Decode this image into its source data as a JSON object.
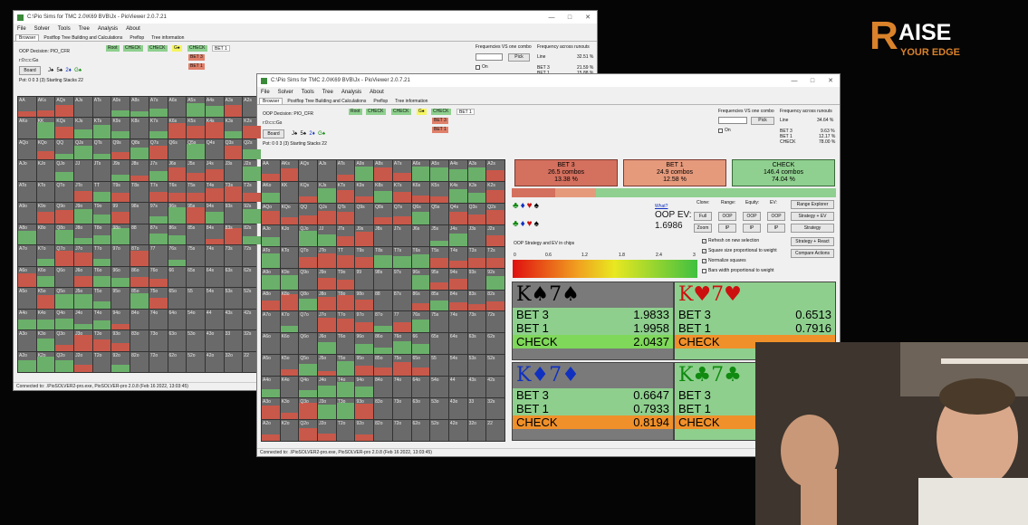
{
  "branding": {
    "logo_mark": "R",
    "logo_line1": "AISE",
    "logo_line2": "YOUR EDGE",
    "accent": "#d9822b"
  },
  "back_window": {
    "title": "C:\\Pio Sims for TMC 2.0\\K69 BVB\\Jx - PioViewer 2.0.7.21",
    "menu": [
      "File",
      "Solver",
      "Tools",
      "Tree",
      "Analysis",
      "About"
    ],
    "tabs": [
      "Browser",
      "Postflop Tree Building and Calculations",
      "Preflop",
      "Tree information"
    ],
    "decision": "OOP Decision:  PIO_CFR",
    "line": "r:0:c:c:Gs",
    "board_button": "Board",
    "board_cards": [
      "J♠",
      "5♠",
      "2♦",
      "G♠"
    ],
    "pot": "Pot: 0 0 3 (3)  Starting Stacks 22",
    "tree": [
      "Root",
      "CHECK",
      "CHECK",
      "G♠",
      "CHECK",
      "BET 1"
    ],
    "tree_sub": [
      "BET 3",
      "BET 1"
    ],
    "freq_label": "Frequencies VS one combo",
    "freq_runouts": "Frequency across runouts",
    "pick": "Pick",
    "on_label": "On",
    "line_label": "Line",
    "line_value": "32.51 %",
    "bet3_label": "BET 3",
    "bet3_value": "21.59 %",
    "bet1_label": "BET 1",
    "bet1_value": "15.88 %",
    "status": "Connected to: .\\PioSOLVER2-pro.exe, PioSOLVER-pro 2.0.8 (Feb 16 2022, 13:03:45)"
  },
  "front_window": {
    "title": "C:\\Pio Sims for TMC 2.0\\K69 BVB\\Jx - PioViewer 2.0.7.21",
    "menu": [
      "File",
      "Solver",
      "Tools",
      "Tree",
      "Analysis",
      "About"
    ],
    "tabs": [
      "Browser",
      "Postflop Tree Building and Calculations",
      "Preflop",
      "Tree information"
    ],
    "decision": "OOP Decision:  PIO_CFR",
    "line": "r:0:c:c:Gs",
    "board_button": "Board",
    "board_cards": [
      "J♠",
      "5♠",
      "2♦",
      "G♠"
    ],
    "pot": "Pot: 0 0 3 (3)  Starting Stacks 22",
    "tree": [
      "Root",
      "CHECK",
      "CHECK",
      "G♠",
      "CHECK",
      "BET 1"
    ],
    "tree_sub": [
      "BET 3",
      "BET 1"
    ],
    "freq_label": "Frequencies VS one combo",
    "freq_runouts": "Frequency across runouts",
    "pick": "Pick",
    "on_label": "On",
    "line_label": "Line",
    "line_value": "34.64 %",
    "runout_rows": [
      {
        "label": "BET 3",
        "value": "9.63 %"
      },
      {
        "label": "BET 1",
        "value": "12.17 %"
      },
      {
        "label": "CHECK",
        "value": "78.00 %"
      }
    ],
    "actions": [
      {
        "name": "BET 3",
        "combos": "26.5 combos",
        "pct": "13.38 %",
        "color": "#d4705e"
      },
      {
        "name": "BET 1",
        "combos": "24.9 combos",
        "pct": "12.58 %",
        "color": "#e69a7c"
      },
      {
        "name": "CHECK",
        "combos": "146.4 combos",
        "pct": "74.04 %",
        "color": "#8fcf8f"
      }
    ],
    "what_link": "What?",
    "oop_ev_label": "OOP EV:",
    "oop_ev_value": "1.6986",
    "col_headers": [
      "Clone:",
      "Range:",
      "Equity:",
      "EV:"
    ],
    "small_buttons": [
      "Full",
      "Zoom",
      "OOP",
      "IP",
      "OOP",
      "IP",
      "OOP",
      "IP"
    ],
    "right_buttons": [
      "Range Explorer",
      "Strategy + EV",
      "Strategy",
      "Strategy + React",
      "Compare Actions"
    ],
    "checkboxes": [
      "Refresh on new selection",
      "Square size proportional to weight",
      "Normalize squares",
      "Bars width proportional to weight"
    ],
    "strategy_label": "OOP Strategy and EV in chips",
    "scale": [
      "0",
      "0.6",
      "1.2",
      "1.8",
      "2.4",
      "3"
    ],
    "status": "Connected to: .\\PioSOLVER2-pro.exe, PioSOLVER-pro 2.0.8 (Feb 16 2022, 13:03:45)"
  },
  "combos": [
    {
      "hand": "K♠7♠",
      "suit_color": "#000000",
      "rows": [
        [
          "BET 3",
          "1.9833"
        ],
        [
          "BET 1",
          "1.9958"
        ],
        [
          "CHECK",
          "2.0437"
        ]
      ]
    },
    {
      "hand": "K♥7♥",
      "suit_color": "#cc1010",
      "rows": [
        [
          "BET 3",
          "0.6513"
        ],
        [
          "BET 1",
          "0.7916"
        ],
        [
          "CHECK",
          ""
        ]
      ]
    },
    {
      "hand": "K♦7♦",
      "suit_color": "#1030c0",
      "rows": [
        [
          "BET 3",
          "0.6647"
        ],
        [
          "BET 1",
          "0.7933"
        ],
        [
          "CHECK",
          "0.8194"
        ]
      ]
    },
    {
      "hand": "K♣7♣",
      "suit_color": "#108a10",
      "rows": [
        [
          "BET 3",
          ""
        ],
        [
          "BET 1",
          ""
        ],
        [
          "CHECK",
          ""
        ]
      ]
    }
  ],
  "matrix_labels": [
    [
      "AA",
      "AKs",
      "AQs",
      "AJs",
      "ATs",
      "A9s",
      "A8s",
      "A7s",
      "A6s",
      "A5s",
      "A4s",
      "A3s",
      "A2s"
    ],
    [
      "AKo",
      "KK",
      "KQs",
      "KJs",
      "KTs",
      "K9s",
      "K8s",
      "K7s",
      "K6s",
      "K5s",
      "K4s",
      "K3s",
      "K2s"
    ],
    [
      "AQo",
      "KQo",
      "QQ",
      "QJs",
      "QTs",
      "Q9s",
      "Q8s",
      "Q7s",
      "Q6s",
      "Q5s",
      "Q4s",
      "Q3s",
      "Q2s"
    ],
    [
      "AJo",
      "KJo",
      "QJo",
      "JJ",
      "JTs",
      "J9s",
      "J8s",
      "J7s",
      "J6s",
      "J5s",
      "J4s",
      "J3s",
      "J2s"
    ],
    [
      "ATo",
      "KTo",
      "QTo",
      "JTo",
      "TT",
      "T9s",
      "T8s",
      "T7s",
      "T6s",
      "T5s",
      "T4s",
      "T3s",
      "T2s"
    ],
    [
      "A9o",
      "K9o",
      "Q9o",
      "J9o",
      "T9o",
      "99",
      "98s",
      "97s",
      "96s",
      "95s",
      "94s",
      "93s",
      "92s"
    ],
    [
      "A8o",
      "K8o",
      "Q8o",
      "J8o",
      "T8o",
      "98o",
      "88",
      "87s",
      "86s",
      "85s",
      "84s",
      "83s",
      "82s"
    ],
    [
      "A7o",
      "K7o",
      "Q7o",
      "J7o",
      "T7o",
      "97o",
      "87o",
      "77",
      "76s",
      "75s",
      "74s",
      "73s",
      "72s"
    ],
    [
      "A6o",
      "K6o",
      "Q6o",
      "J6o",
      "T6o",
      "96o",
      "86o",
      "76o",
      "66",
      "65s",
      "64s",
      "63s",
      "62s"
    ],
    [
      "A5o",
      "K5o",
      "Q5o",
      "J5o",
      "T5o",
      "95o",
      "85o",
      "75o",
      "65o",
      "55",
      "54s",
      "53s",
      "52s"
    ],
    [
      "A4o",
      "K4o",
      "Q4o",
      "J4o",
      "T4o",
      "94o",
      "84o",
      "74o",
      "64o",
      "54o",
      "44",
      "43s",
      "42s"
    ],
    [
      "A3o",
      "K3o",
      "Q3o",
      "J3o",
      "T3o",
      "93o",
      "83o",
      "73o",
      "63o",
      "53o",
      "43o",
      "33",
      "32s"
    ],
    [
      "A2o",
      "K2o",
      "Q2o",
      "J2o",
      "T2o",
      "92o",
      "82o",
      "72o",
      "62o",
      "52o",
      "42o",
      "32o",
      "22"
    ]
  ]
}
